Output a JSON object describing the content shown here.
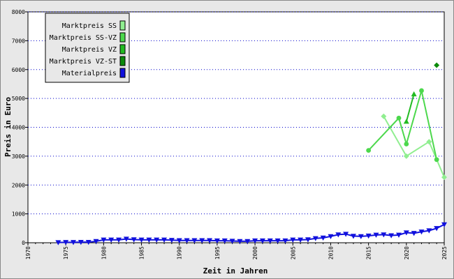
{
  "chart_data": {
    "type": "line",
    "xlabel": "Zeit in Jahren",
    "ylabel": "Preis in Euro",
    "xlim": [
      1970,
      2025
    ],
    "ylim": [
      0,
      8000
    ],
    "x_ticks": [
      1970,
      1975,
      1980,
      1985,
      1990,
      1995,
      2000,
      2005,
      2010,
      2015,
      2020,
      2025
    ],
    "y_ticks": [
      0,
      1000,
      2000,
      3000,
      4000,
      5000,
      6000,
      7000,
      8000
    ],
    "grid": "horizontal dotted",
    "legend_position": "top-left",
    "series": [
      {
        "name": "Marktpreis SS",
        "color": "#90ee90",
        "marker": "diamond",
        "x": [
          2017,
          2020,
          2023,
          2025
        ],
        "y": [
          4380,
          3000,
          3500,
          2270
        ]
      },
      {
        "name": "Marktpreis SS-VZ",
        "color": "#4cd84c",
        "marker": "circle",
        "x": [
          2015,
          2019,
          2020,
          2022,
          2024
        ],
        "y": [
          3200,
          4320,
          3420,
          5270,
          2880
        ]
      },
      {
        "name": "Marktpreis VZ",
        "color": "#22bb22",
        "marker": "triangle-up",
        "x": [
          2020,
          2021
        ],
        "y": [
          4200,
          5150
        ]
      },
      {
        "name": "Marktpreis VZ-ST",
        "color": "#0b8a0b",
        "marker": "diamond",
        "x": [
          2024
        ],
        "y": [
          6150
        ]
      },
      {
        "name": "Materialpreis",
        "color": "#1010dd",
        "marker": "triangle-down",
        "x": [
          1974,
          1975,
          1976,
          1977,
          1978,
          1979,
          1980,
          1981,
          1982,
          1983,
          1984,
          1985,
          1986,
          1987,
          1988,
          1989,
          1990,
          1991,
          1992,
          1993,
          1994,
          1995,
          1996,
          1997,
          1998,
          1999,
          2000,
          2001,
          2002,
          2003,
          2004,
          2005,
          2006,
          2007,
          2008,
          2009,
          2010,
          2011,
          2012,
          2013,
          2014,
          2015,
          2016,
          2017,
          2018,
          2019,
          2020,
          2021,
          2022,
          2023,
          2024,
          2025
        ],
        "y": [
          10,
          15,
          15,
          20,
          20,
          50,
          100,
          100,
          100,
          130,
          110,
          100,
          100,
          100,
          100,
          90,
          80,
          80,
          80,
          80,
          80,
          70,
          70,
          60,
          50,
          50,
          70,
          70,
          70,
          70,
          70,
          100,
          100,
          110,
          150,
          170,
          220,
          280,
          300,
          230,
          220,
          240,
          270,
          280,
          250,
          270,
          350,
          330,
          380,
          420,
          500,
          630
        ]
      }
    ]
  }
}
